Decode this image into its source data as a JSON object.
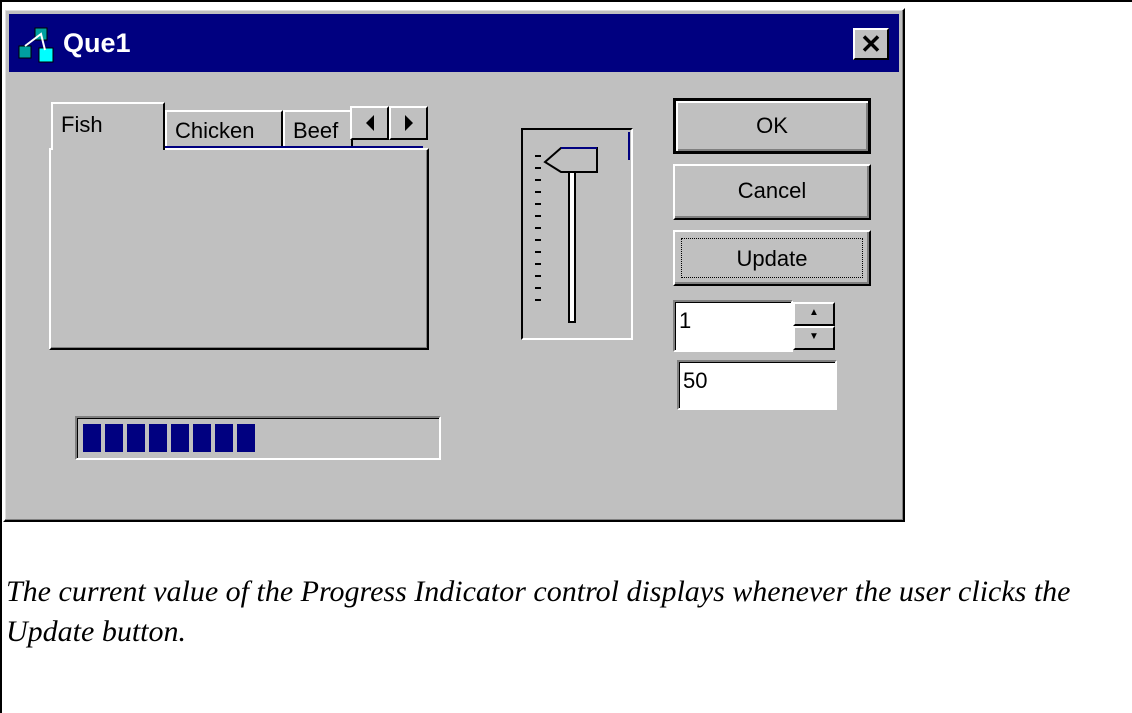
{
  "window": {
    "title": "Que1",
    "close_label": "✕"
  },
  "tabs": [
    {
      "label": "Fish"
    },
    {
      "label": "Chicken"
    },
    {
      "label": "Beef"
    }
  ],
  "buttons": {
    "ok": "OK",
    "cancel": "Cancel",
    "update": "Update"
  },
  "spin": {
    "value": "1"
  },
  "value_field": {
    "value": "50"
  },
  "progress": {
    "percent": 50,
    "segments_filled": 8
  },
  "slider": {
    "position_percent": 0
  },
  "caption": "The current value of the Progress Indicator control displays whenever the user clicks the Update button."
}
